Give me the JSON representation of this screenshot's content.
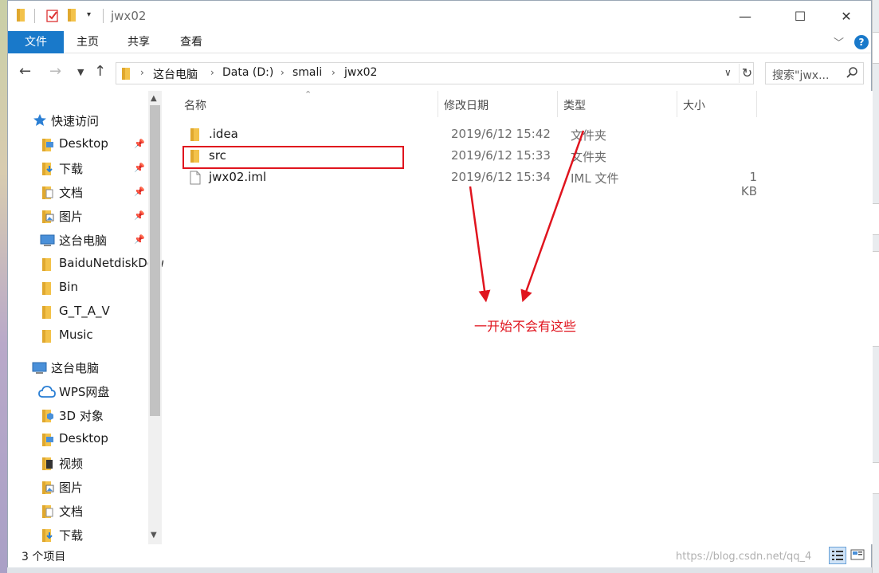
{
  "window": {
    "title": "jwx02",
    "controls": {
      "minimize": "—",
      "maximize": "☐",
      "close": "✕"
    }
  },
  "ribbon": {
    "tabs": [
      "文件",
      "主页",
      "共享",
      "查看"
    ],
    "help": "?"
  },
  "address": {
    "crumbs": [
      "这台电脑",
      "Data (D:)",
      "smali",
      "jwx02"
    ]
  },
  "search": {
    "placeholder": "搜索\"jwx..."
  },
  "navpane": {
    "quick_access": "快速访问",
    "pinned": [
      "Desktop",
      "下载",
      "文档",
      "图片",
      "这台电脑"
    ],
    "folders": [
      "BaiduNetdiskDownload",
      "Bin",
      "G_T_A_V",
      "Music"
    ],
    "this_pc": "这台电脑",
    "pc_items": [
      "WPS网盘",
      "3D 对象",
      "Desktop",
      "视频",
      "图片",
      "文档",
      "下载"
    ]
  },
  "columns": {
    "name": "名称",
    "date": "修改日期",
    "type": "类型",
    "size": "大小"
  },
  "files": [
    {
      "name": ".idea",
      "date": "2019/6/12 15:42",
      "type": "文件夹",
      "size": ""
    },
    {
      "name": "src",
      "date": "2019/6/12 15:33",
      "type": "文件夹",
      "size": ""
    },
    {
      "name": "jwx02.iml",
      "date": "2019/6/12 15:34",
      "type": "IML 文件",
      "size": "1 KB"
    }
  ],
  "annotation": {
    "text": "一开始不会有这些",
    "color": "#e0141e"
  },
  "status": {
    "count": "3 个项目"
  },
  "watermark": "https://blog.csdn.net/qq_4",
  "colors": {
    "accent": "#1979ca",
    "folder": "#f3c24a",
    "annotation": "#e0141e"
  }
}
